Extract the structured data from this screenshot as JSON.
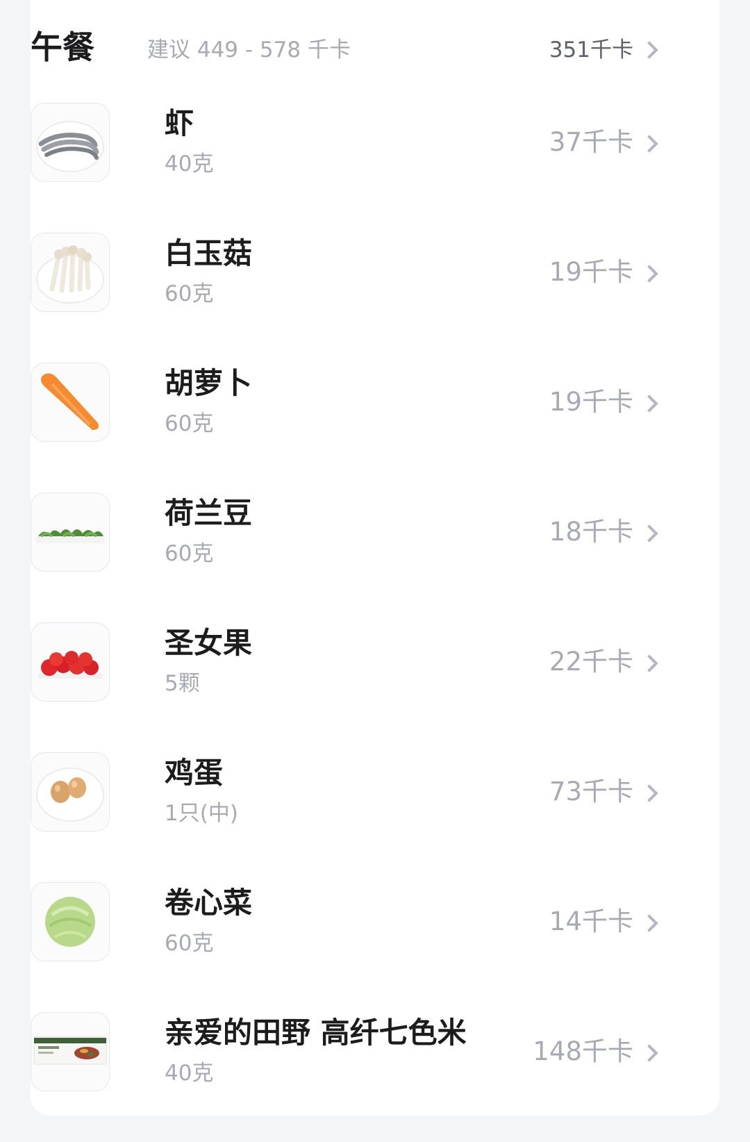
{
  "meal": {
    "title": "午餐",
    "suggest": "建议 449 - 578 千卡",
    "total": "351千卡"
  },
  "foods": [
    {
      "name": "虾",
      "amount": "40克",
      "kcal": "37千卡",
      "icon": "shrimp-icon"
    },
    {
      "name": "白玉菇",
      "amount": "60克",
      "kcal": "19千卡",
      "icon": "mushroom-icon"
    },
    {
      "name": "胡萝卜",
      "amount": "60克",
      "kcal": "19千卡",
      "icon": "carrot-icon"
    },
    {
      "name": "荷兰豆",
      "amount": "60克",
      "kcal": "18千卡",
      "icon": "snow-pea-icon"
    },
    {
      "name": "圣女果",
      "amount": "5颗",
      "kcal": "22千卡",
      "icon": "cherry-tomato-icon"
    },
    {
      "name": "鸡蛋",
      "amount": "1只(中)",
      "kcal": "73千卡",
      "icon": "egg-icon"
    },
    {
      "name": "卷心菜",
      "amount": "60克",
      "kcal": "14千卡",
      "icon": "cabbage-icon"
    },
    {
      "name": "亲爱的田野 高纤七色米",
      "amount": "40克",
      "kcal": "148千卡",
      "icon": "rice-package-icon"
    }
  ]
}
